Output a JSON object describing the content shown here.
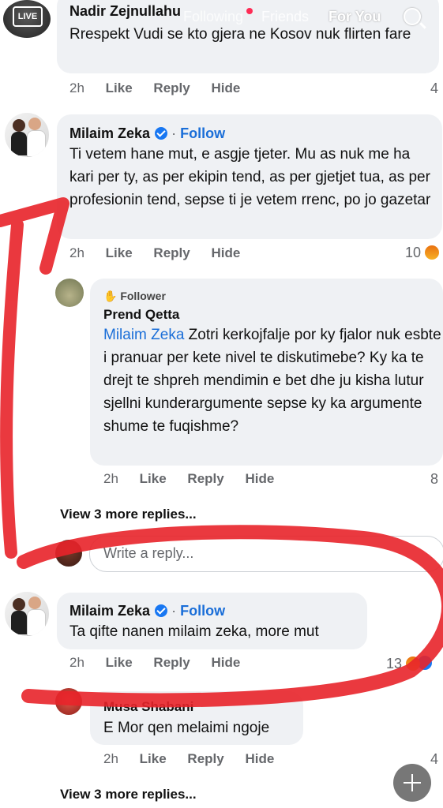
{
  "topbar": {
    "live_label": "LIVE",
    "tabs": [
      "Following",
      "Friends",
      "For You"
    ]
  },
  "comments": [
    {
      "author": "Nadir Zejnullahu",
      "text": "Rrespekt Vudi se kto gjera ne Kosov nuk flirten fare",
      "time": "2h",
      "like": "Like",
      "reply": "Reply",
      "hide": "Hide",
      "reactions": "4"
    },
    {
      "author": "Milaim Zeka",
      "follow": "Follow",
      "text": "Ti vetem hane mut, e asgje tjeter. Mu as nuk me ha kari per ty, as per ekipin tend, as per gjetjet tua, as per profesionin tend, sepse ti je vetem rrenc, po jo gazetar",
      "time": "2h",
      "like": "Like",
      "reply": "Reply",
      "hide": "Hide",
      "reactions": "10"
    },
    {
      "badge": "Follower",
      "author": "Prend Qetta",
      "mention": "Milaim Zeka",
      "text": " Zotri kerkojfalje por ky fjalor nuk esbte i pranuar per kete nivel te diskutimebe? Ky ka te drejt te shpreh mendimin e bet dhe ju kisha lutur sjellni kunderargumente sepse ky ka argumente shume te fuqishme?",
      "time": "2h",
      "like": "Like",
      "reply": "Reply",
      "hide": "Hide",
      "reactions": "8"
    },
    {
      "author": "Milaim Zeka",
      "follow": "Follow",
      "text": "Ta qifte nanen milaim zeka, more mut",
      "time": "2h",
      "like": "Like",
      "reply": "Reply",
      "hide": "Hide",
      "reactions": "13"
    },
    {
      "author": "Musa Shabani",
      "text": "E Mor qen melaimi ngoje",
      "time": "2h",
      "like": "Like",
      "reply": "Reply",
      "hide": "Hide",
      "reactions": "4"
    }
  ],
  "view_more_1": "View 3 more replies...",
  "view_more_2": "View 3 more replies...",
  "reply_input": {
    "placeholder": "Write a reply..."
  },
  "colors": {
    "annotation": "#e8232a",
    "link": "#1a6ed8",
    "bubble": "#eff1f4"
  }
}
